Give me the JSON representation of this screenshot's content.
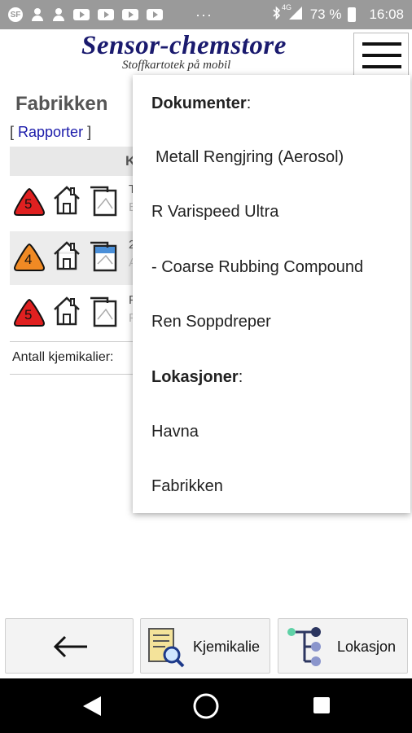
{
  "status_bar": {
    "network": "4G",
    "battery_text": "73 %",
    "time": "16:08",
    "sf_badge": "SF",
    "dots": "···"
  },
  "header": {
    "title": "Sensor-chemstore",
    "subtitle": "Stoffkartotek på mobil"
  },
  "page": {
    "title": "Fabrikken",
    "rapporter_open": "[ ",
    "rapporter_link": "Rapporter",
    "rapporter_close": " ]",
    "table_header_initial": "K",
    "rows": [
      {
        "hazard": "5",
        "hazard_color": "#e02020",
        "text": "T",
        "text2": "E"
      },
      {
        "hazard": "4",
        "hazard_color": "#f08a24",
        "text": "2",
        "text2": "A"
      },
      {
        "hazard": "5",
        "hazard_color": "#e02020",
        "text": "F",
        "text2": "F"
      }
    ],
    "antall_label": "Antall kjemikalier:"
  },
  "dropdown": {
    "documents_header": "Dokumenter",
    "documents_colon": ":",
    "documents": [
      "Metall Rengjring (Aerosol)",
      "R Varispeed Ultra",
      "- Coarse Rubbing Compound",
      "Ren Soppdreper"
    ],
    "locations_header": "Lokasjoner",
    "locations_colon": ":",
    "locations": [
      "Havna",
      "Fabrikken"
    ]
  },
  "bottom_bar": {
    "back_icon": "arrow-left-icon",
    "kjemikalie_label": "Kjemikalie",
    "lokasjon_label": "Lokasjon"
  },
  "colors": {
    "status_bar": "#9a9a9a",
    "logo_blue": "#1a1a6e",
    "link_blue": "#1a1aaa",
    "tree_green": "#5ed1a6",
    "tree_navy": "#2c3660",
    "tree_periwinkle": "#8a95cc"
  }
}
